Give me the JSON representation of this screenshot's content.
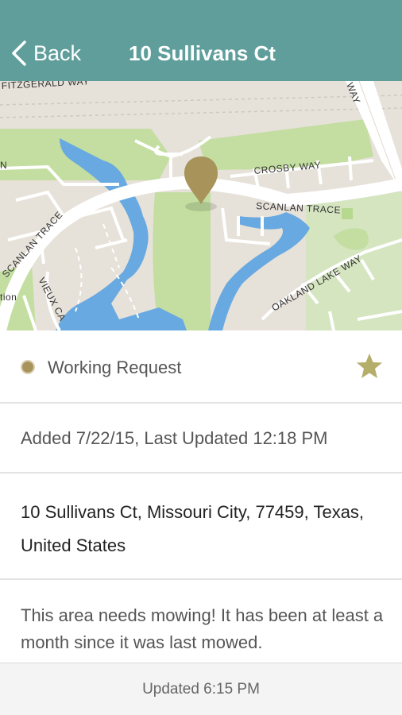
{
  "header": {
    "back_label": "Back",
    "title": "10 Sullivans Ct"
  },
  "map": {
    "street_labels": {
      "fitzgerald": "FITZGERALD WAY",
      "crosby": "CROSBY WAY",
      "scanlan_right": "SCANLAN TRACE",
      "scanlan_left": "SCANLAN TRACE",
      "oakland": "OAKLAND LAKE WAY",
      "vieux": "VIEUX CA",
      "partial_left_n": "N",
      "partial_tion": "tion",
      "partial_way": "WAY"
    },
    "pin_color": "#a8935a"
  },
  "status": {
    "label": "Working Request",
    "dot_color": "#a8935a",
    "star_color": "#b5ad6a"
  },
  "dates": {
    "text": "Added 7/22/15, Last Updated 12:18 PM"
  },
  "address": {
    "text": "10 Sullivans Ct, Missouri City, 77459, Texas, United States"
  },
  "description": {
    "text": "This area needs mowing! It has been at least a month since it was last mowed."
  },
  "footer": {
    "updated": "Updated 6:15 PM"
  },
  "colors": {
    "header": "#5f9e9b",
    "park": "#c3dea0",
    "water": "#67a9e0",
    "land": "#e6e1d9"
  }
}
